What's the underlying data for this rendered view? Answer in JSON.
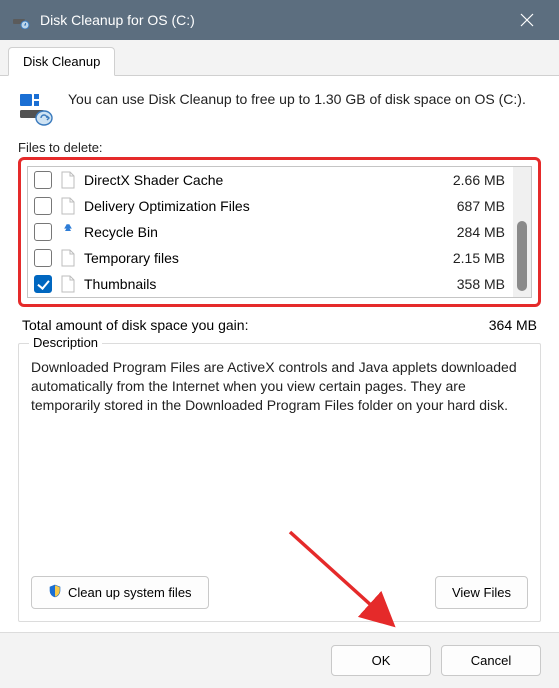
{
  "titlebar": {
    "title": "Disk Cleanup for OS (C:)"
  },
  "tab": {
    "label": "Disk Cleanup"
  },
  "intro": {
    "text": "You can use Disk Cleanup to free up to 1.30 GB of disk space on OS (C:)."
  },
  "files": {
    "label": "Files to delete:",
    "items": [
      {
        "name": "DirectX Shader Cache",
        "size": "2.66 MB",
        "checked": false,
        "icon": "file"
      },
      {
        "name": "Delivery Optimization Files",
        "size": "687 MB",
        "checked": false,
        "icon": "file"
      },
      {
        "name": "Recycle Bin",
        "size": "284 MB",
        "checked": false,
        "icon": "recycle"
      },
      {
        "name": "Temporary files",
        "size": "2.15 MB",
        "checked": false,
        "icon": "file"
      },
      {
        "name": "Thumbnails",
        "size": "358 MB",
        "checked": true,
        "icon": "file"
      }
    ]
  },
  "total": {
    "label": "Total amount of disk space you gain:",
    "value": "364 MB"
  },
  "description": {
    "label": "Description",
    "text": "Downloaded Program Files are ActiveX controls and Java applets downloaded automatically from the Internet when you view certain pages. They are temporarily stored in the Downloaded Program Files folder on your hard disk."
  },
  "buttons": {
    "cleanup": "Clean up system files",
    "viewfiles": "View Files",
    "ok": "OK",
    "cancel": "Cancel"
  }
}
